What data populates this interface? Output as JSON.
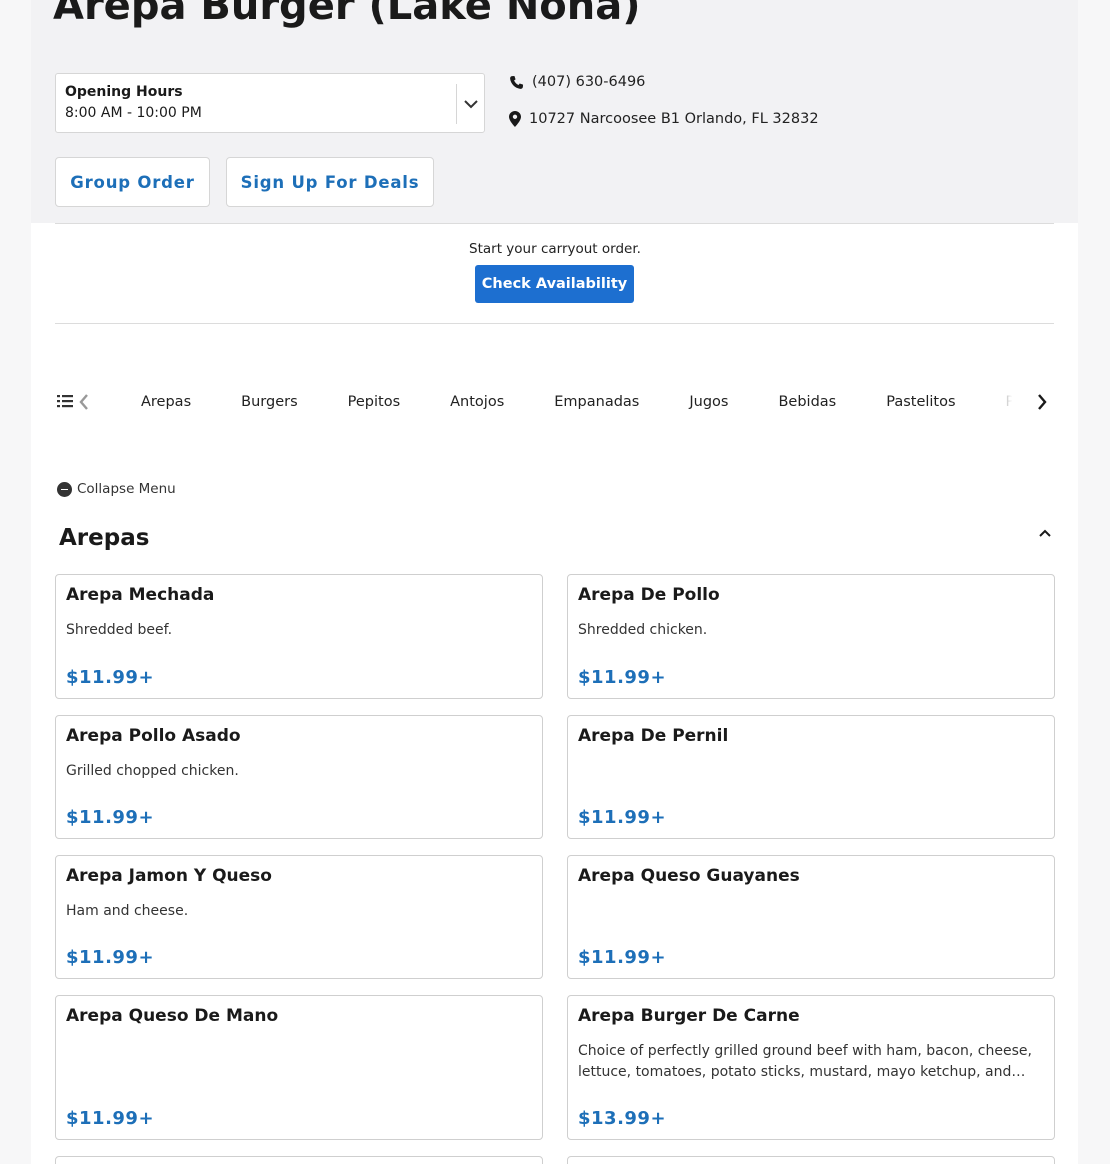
{
  "restaurant": {
    "name": "Arepa Burger (Lake Nona)",
    "hours_label": "Opening Hours",
    "hours_value": "8:00 AM - 10:00 PM",
    "phone": "(407) 630-6496",
    "address": "10727 Narcoosee B1 Orlando, FL 32832"
  },
  "actions": {
    "group_order": "Group Order",
    "sign_up": "Sign Up For Deals"
  },
  "carryout": {
    "prompt": "Start your carryout order.",
    "button": "Check Availability"
  },
  "categories": [
    "Arepas",
    "Burgers",
    "Pepitos",
    "Antojos",
    "Empanadas",
    "Jugos",
    "Bebidas",
    "Pastelitos",
    "Pa"
  ],
  "collapse_menu": "Collapse Menu",
  "section": {
    "title": "Arepas",
    "items": [
      {
        "name": "Arepa Mechada",
        "desc": "Shredded beef.",
        "price": "$11.99+"
      },
      {
        "name": "Arepa De Pollo",
        "desc": "Shredded chicken.",
        "price": "$11.99+"
      },
      {
        "name": "Arepa Pollo Asado",
        "desc": "Grilled chopped chicken.",
        "price": "$11.99+"
      },
      {
        "name": "Arepa De Pernil",
        "desc": "",
        "price": "$11.99+"
      },
      {
        "name": "Arepa Jamon Y Queso",
        "desc": "Ham and cheese.",
        "price": "$11.99+"
      },
      {
        "name": "Arepa Queso Guayanes",
        "desc": "",
        "price": "$11.99+"
      },
      {
        "name": "Arepa Queso De Mano",
        "desc": "",
        "price": "$11.99+"
      },
      {
        "name": "Arepa Burger De Carne",
        "desc": "Choice of perfectly grilled ground beef with ham, bacon, cheese, lettuce, tomatoes, potato sticks, mustard, mayo ketchup, and…",
        "price": "$13.99+"
      }
    ]
  },
  "colors": {
    "accent": "#1d6fb8",
    "button": "#1d6fd0"
  }
}
